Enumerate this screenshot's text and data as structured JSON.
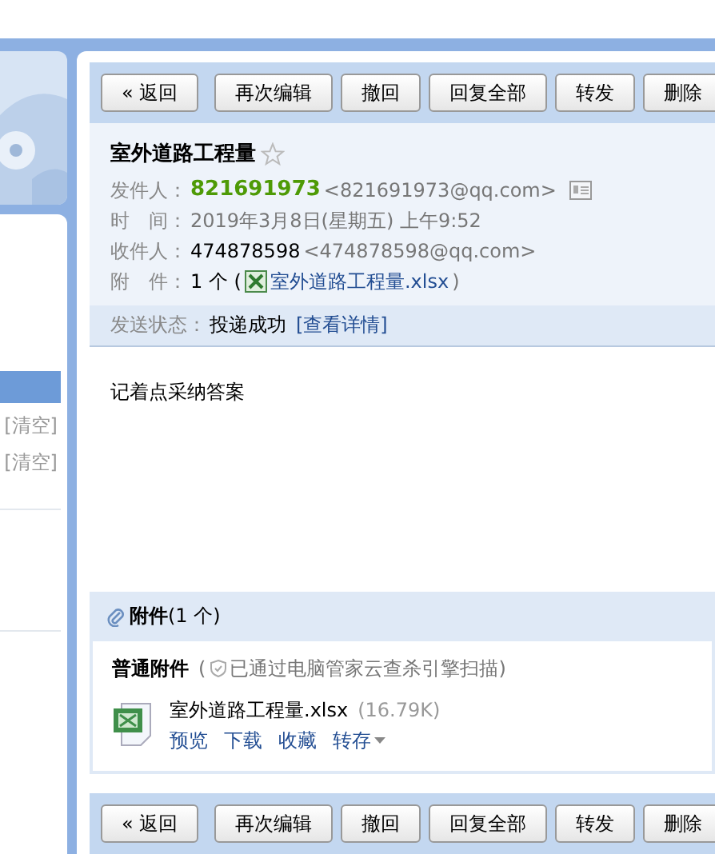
{
  "sidebar": {
    "items": [
      {
        "label": "[清空]"
      },
      {
        "label": "[清空]"
      }
    ]
  },
  "toolbars": {
    "top": {
      "buttons": [
        {
          "label": "« 返回"
        },
        {
          "label": "再次编辑"
        },
        {
          "label": "撤回"
        },
        {
          "label": "回复全部"
        },
        {
          "label": "转发"
        },
        {
          "label": "删除"
        }
      ]
    },
    "bottom": {
      "buttons": [
        {
          "label": "« 返回"
        },
        {
          "label": "再次编辑"
        },
        {
          "label": "撤回"
        },
        {
          "label": "回复全部"
        },
        {
          "label": "转发"
        },
        {
          "label": "删除"
        }
      ]
    }
  },
  "mail": {
    "subject": "室外道路工程量",
    "starred": false,
    "sender": {
      "label": "发件人：",
      "name": "821691973",
      "address": "<821691973@qq.com>"
    },
    "time": {
      "label": "时　间：",
      "value": "2019年3月8日(星期五) 上午9:52"
    },
    "recipient": {
      "label": "收件人：",
      "name": "474878598",
      "address": "<474878598@qq.com>"
    },
    "attachment_line": {
      "label": "附　件：",
      "count": "1 个 (",
      "file": "室外道路工程量.xlsx",
      "close": ")"
    },
    "status": {
      "label": "发送状态：",
      "value": "投递成功",
      "link": "[查看详情]"
    },
    "body": "记着点采纳答案"
  },
  "attachments": {
    "title": "附件",
    "count": "(1 个)",
    "group": "普通附件",
    "scan_note": "(",
    "scan_text": "已通过电脑管家云查杀引擎扫描)",
    "files": [
      {
        "name": "室外道路工程量.xlsx",
        "size": "(16.79K)",
        "actions": [
          "预览",
          "下载",
          "收藏",
          "转存"
        ]
      }
    ]
  }
}
